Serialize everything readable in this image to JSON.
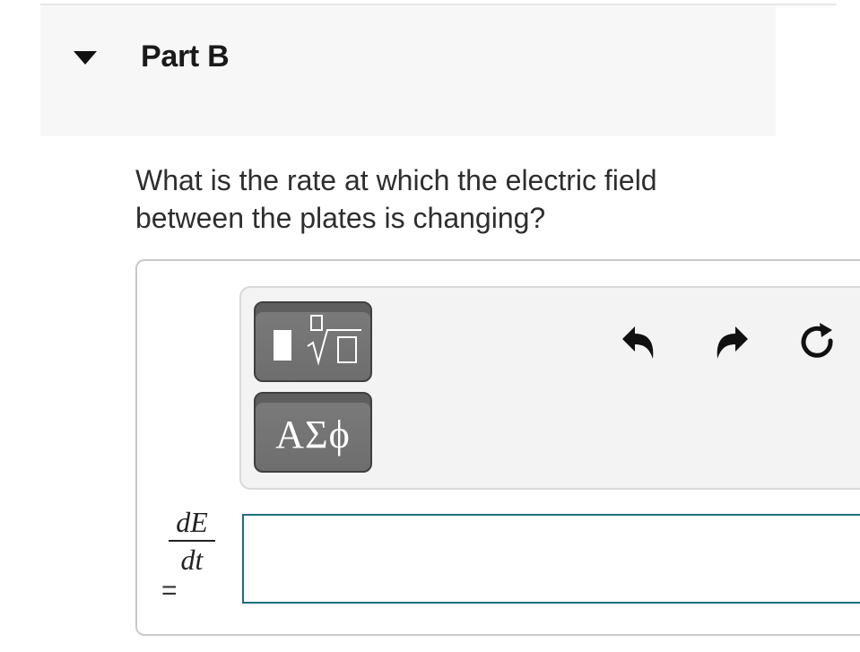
{
  "part": {
    "title": "Part B",
    "expanded": true,
    "caret_icon": "caret-down-icon"
  },
  "question": {
    "text": "What is the rate at which the electric field between the plates is changing?"
  },
  "toolbar": {
    "templates_button": {
      "icon": "templates-radical-icon"
    },
    "symbols_button": {
      "label": "ΑΣϕ"
    },
    "undo": {
      "icon": "undo-icon"
    },
    "redo": {
      "icon": "redo-icon"
    },
    "reset": {
      "icon": "reset-icon"
    }
  },
  "answer": {
    "lhs_numerator": "dE",
    "lhs_denominator": "dt",
    "equals": "=",
    "input_value": "",
    "input_border_color": "#1b6f80"
  },
  "colors": {
    "header_bg": "#f7f7f7",
    "toolbar_bg": "#f3f3f3",
    "button_bg": "#767676"
  }
}
